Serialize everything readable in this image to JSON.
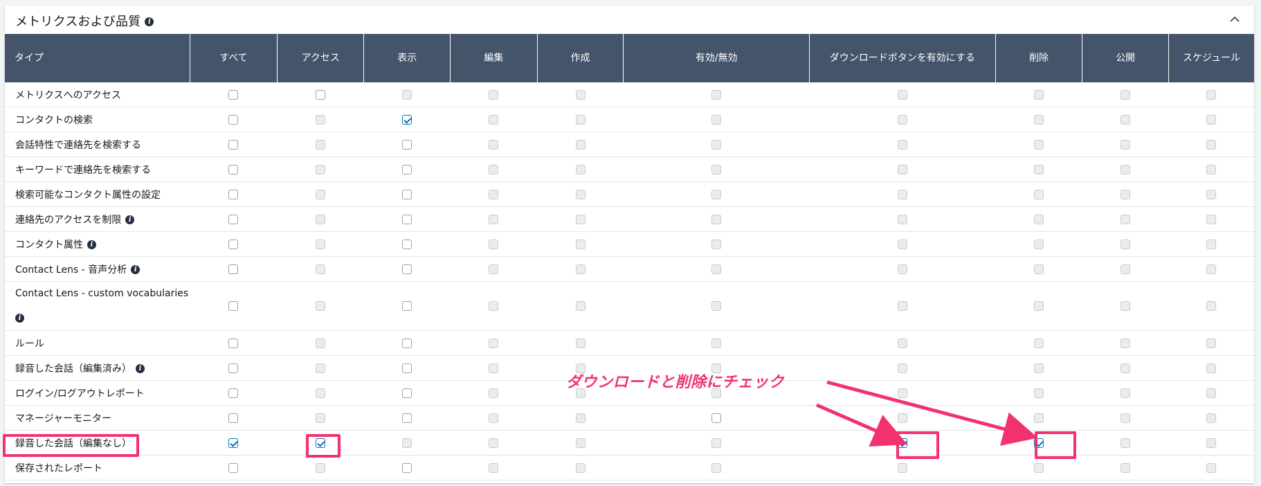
{
  "panel": {
    "title": "メトリクスおよび品質",
    "info_icon": "info-icon",
    "collapse_icon": "chevron-up-icon"
  },
  "table": {
    "columns": [
      "タイプ",
      "すべて",
      "アクセス",
      "表示",
      "編集",
      "作成",
      "有効/無効",
      "ダウンロードボタンを有効にする",
      "削除",
      "公開",
      "スケジュール"
    ],
    "rows": [
      {
        "label": "メトリクスへのアクセス",
        "info": false,
        "tall": false,
        "cells": [
          "e",
          "e",
          "d",
          "d",
          "d",
          "d",
          "d",
          "d",
          "d",
          "d"
        ]
      },
      {
        "label": "コンタクトの検索",
        "info": false,
        "tall": false,
        "cells": [
          "e",
          "d",
          "c",
          "d",
          "d",
          "d",
          "d",
          "d",
          "d",
          "d"
        ]
      },
      {
        "label": "会話特性で連絡先を検索する",
        "info": false,
        "tall": false,
        "cells": [
          "e",
          "d",
          "e",
          "d",
          "d",
          "d",
          "d",
          "d",
          "d",
          "d"
        ]
      },
      {
        "label": "キーワードで連絡先を検索する",
        "info": false,
        "tall": false,
        "cells": [
          "e",
          "d",
          "e",
          "d",
          "d",
          "d",
          "d",
          "d",
          "d",
          "d"
        ]
      },
      {
        "label": "検索可能なコンタクト属性の設定",
        "info": false,
        "tall": false,
        "cells": [
          "e",
          "d",
          "e",
          "d",
          "d",
          "d",
          "d",
          "d",
          "d",
          "d"
        ]
      },
      {
        "label": "連絡先のアクセスを制限",
        "info": true,
        "tall": false,
        "cells": [
          "e",
          "d",
          "e",
          "d",
          "d",
          "d",
          "d",
          "d",
          "d",
          "d"
        ]
      },
      {
        "label": "コンタクト属性",
        "info": true,
        "tall": false,
        "cells": [
          "e",
          "d",
          "e",
          "d",
          "d",
          "d",
          "d",
          "d",
          "d",
          "d"
        ]
      },
      {
        "label": "Contact Lens - 音声分析",
        "info": true,
        "tall": false,
        "cells": [
          "e",
          "d",
          "e",
          "d",
          "d",
          "d",
          "d",
          "d",
          "d",
          "d"
        ]
      },
      {
        "label": "Contact Lens - custom vocabularies",
        "info": true,
        "tall": true,
        "cells": [
          "e",
          "d",
          "e",
          "d",
          "d",
          "d",
          "d",
          "d",
          "d",
          "d"
        ]
      },
      {
        "label": "ルール",
        "info": false,
        "tall": false,
        "cells": [
          "e",
          "d",
          "e",
          "d",
          "d",
          "d",
          "d",
          "d",
          "d",
          "d"
        ]
      },
      {
        "label": "録音した会話（編集済み）",
        "info": true,
        "tall": false,
        "cells": [
          "e",
          "d",
          "e",
          "d",
          "d",
          "d",
          "d",
          "d",
          "d",
          "d"
        ]
      },
      {
        "label": "ログイン/ログアウトレポート",
        "info": false,
        "tall": false,
        "cells": [
          "e",
          "d",
          "e",
          "d",
          "d",
          "d",
          "d",
          "d",
          "d",
          "d"
        ]
      },
      {
        "label": "マネージャーモニター",
        "info": false,
        "tall": false,
        "cells": [
          "e",
          "d",
          "e",
          "d",
          "d",
          "e",
          "d",
          "d",
          "d",
          "d"
        ]
      },
      {
        "label": "録音した会話（編集なし）",
        "info": false,
        "tall": false,
        "cells": [
          "c",
          "c",
          "d",
          "d",
          "d",
          "d",
          "c",
          "c",
          "d",
          "d"
        ]
      },
      {
        "label": "保存されたレポート",
        "info": false,
        "tall": false,
        "cells": [
          "e",
          "d",
          "e",
          "d",
          "d",
          "d",
          "d",
          "d",
          "d",
          "d"
        ]
      }
    ]
  },
  "annotation": {
    "text": "ダウンロードと削除にチェック",
    "color": "#f2326e"
  },
  "colors": {
    "header_bg": "#44546a",
    "checkbox_check": "#0073bb",
    "highlight": "#f2326e"
  }
}
